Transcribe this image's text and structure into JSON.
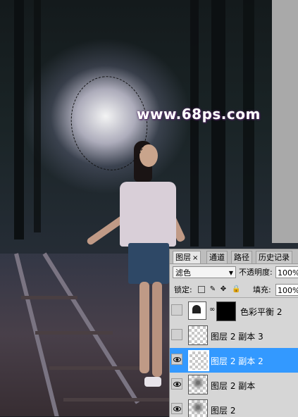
{
  "watermark": "www.68ps.com",
  "panel": {
    "tabs": [
      {
        "label": "图层",
        "close": "×"
      },
      {
        "label": "通道"
      },
      {
        "label": "路径"
      },
      {
        "label": "历史记录"
      }
    ],
    "blend_mode": "滤色",
    "opacity_label": "不透明度:",
    "opacity_value": "100%",
    "lock_label": "锁定:",
    "fill_label": "填充:",
    "fill_value": "100%",
    "layers": [
      {
        "name": "色彩平衡 2",
        "visible": false,
        "type": "adjustment"
      },
      {
        "name": "图层 2 副本 3",
        "visible": false,
        "type": "pixel"
      },
      {
        "name": "图层 2 副本 2",
        "visible": true,
        "type": "pixel",
        "selected": true
      },
      {
        "name": "图层 2 副本",
        "visible": true,
        "type": "pixel"
      },
      {
        "name": "图层 2",
        "visible": true,
        "type": "pixel"
      }
    ]
  },
  "colors": {
    "selection": "#3399ff",
    "panel_bg": "#d6d6d6"
  }
}
